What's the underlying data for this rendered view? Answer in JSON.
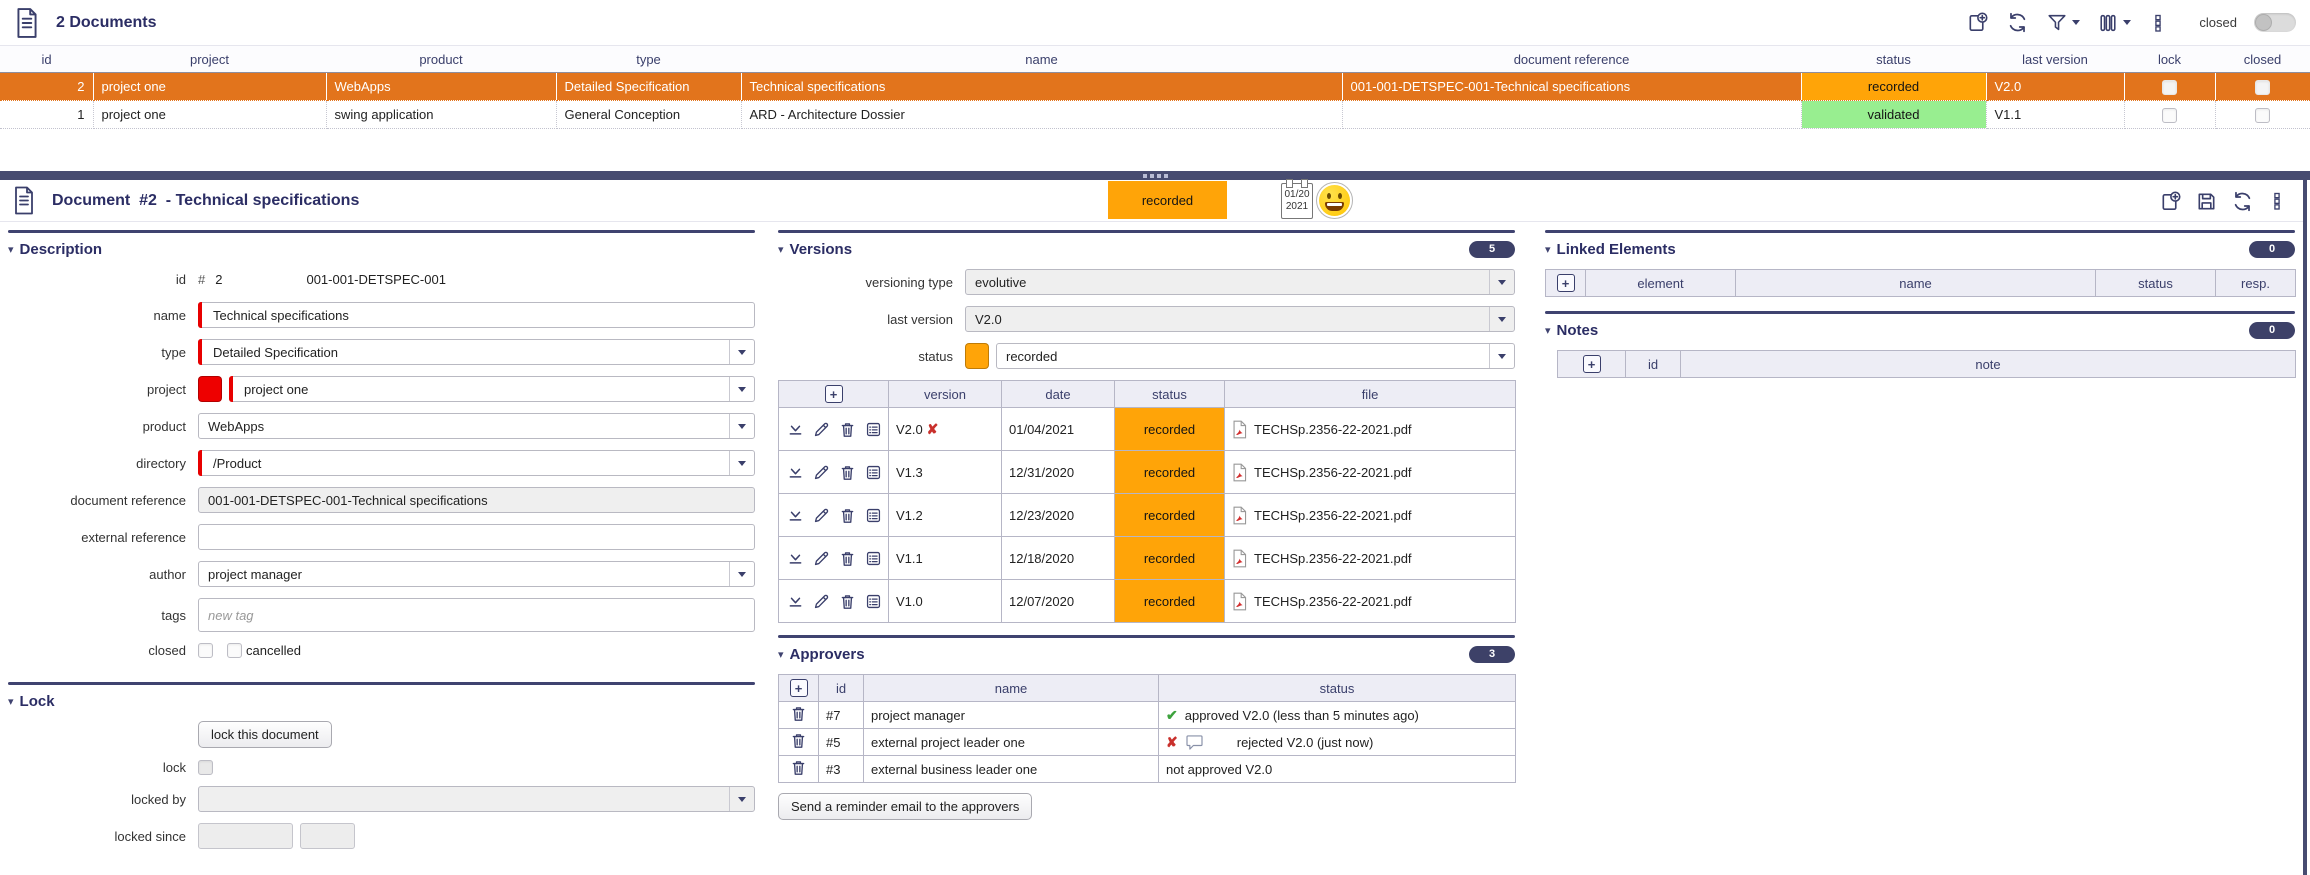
{
  "colors": {
    "accent_navy": "#2B2D64",
    "selected_row": "#E2741C",
    "status": {
      "recorded": "#FFA408",
      "validated": "#98EE90"
    },
    "required_red": "#E80000",
    "count_pill": "#3D4168",
    "project_swatch": "#EE0000"
  },
  "icons": {
    "caret_down": "▾",
    "check_mark": "✔",
    "reject_cross": "✘",
    "remove_cross": "✘",
    "plus": "+"
  },
  "list": {
    "title": "2 Documents",
    "toolbar": {
      "closed_toggle_label": "closed"
    },
    "columns": [
      "id",
      "project",
      "product",
      "type",
      "name",
      "document reference",
      "status",
      "last version",
      "lock",
      "closed"
    ],
    "rows": [
      {
        "id": "2",
        "project": "project one",
        "product": "WebApps",
        "type": "Detailed Specification",
        "name": "Technical specifications",
        "document_reference": "001-001-DETSPEC-001-Technical specifications",
        "status": "recorded",
        "last_version": "V2.0",
        "lock": false,
        "closed": false,
        "selected": true
      },
      {
        "id": "1",
        "project": "project one",
        "product": "swing application",
        "type": "General Conception",
        "name": "ARD - Architecture Dossier",
        "document_reference": "",
        "status": "validated",
        "last_version": "V1.1",
        "lock": false,
        "closed": false,
        "selected": false
      }
    ]
  },
  "detail": {
    "title": "Document  #2  - Technical specifications",
    "status_badge": "recorded",
    "calendar": {
      "month_day": "01/20",
      "year": "2021"
    },
    "description": {
      "title": "Description",
      "id_label": "id",
      "id_hash": "#",
      "id_value": "2",
      "id_reference": "001-001-DETSPEC-001",
      "name_label": "name",
      "name_value": "Technical specifications",
      "type_label": "type",
      "type_value": "Detailed Specification",
      "project_label": "project",
      "project_value": "project one",
      "product_label": "product",
      "product_value": "WebApps",
      "directory_label": "directory",
      "directory_value": "/Product",
      "document_reference_label": "document reference",
      "document_reference_value": "001-001-DETSPEC-001-Technical specifications",
      "external_reference_label": "external reference",
      "external_reference_value": "",
      "author_label": "author",
      "author_value": "project manager",
      "tags_label": "tags",
      "tags_placeholder": "new tag",
      "closed_label": "closed",
      "cancelled_label": "cancelled"
    },
    "lock": {
      "title": "Lock",
      "lock_button_label": "lock this document",
      "lock_label": "lock",
      "locked_by_label": "locked by",
      "locked_since_label": "locked since"
    },
    "versions": {
      "title": "Versions",
      "count": "5",
      "versioning_type_label": "versioning type",
      "versioning_type_value": "evolutive",
      "last_version_label": "last version",
      "last_version_value": "V2.0",
      "status_label": "status",
      "status_value": "recorded",
      "columns": [
        "",
        "version",
        "date",
        "status",
        "file"
      ],
      "rows": [
        {
          "version": "V2.0",
          "removable": true,
          "date": "01/04/2021",
          "status": "recorded",
          "file": "TECHSp.2356-22-2021.pdf"
        },
        {
          "version": "V1.3",
          "removable": false,
          "date": "12/31/2020",
          "status": "recorded",
          "file": "TECHSp.2356-22-2021.pdf"
        },
        {
          "version": "V1.2",
          "removable": false,
          "date": "12/23/2020",
          "status": "recorded",
          "file": "TECHSp.2356-22-2021.pdf"
        },
        {
          "version": "V1.1",
          "removable": false,
          "date": "12/18/2020",
          "status": "recorded",
          "file": "TECHSp.2356-22-2021.pdf"
        },
        {
          "version": "V1.0",
          "removable": false,
          "date": "12/07/2020",
          "status": "recorded",
          "file": "TECHSp.2356-22-2021.pdf"
        }
      ]
    },
    "approvers": {
      "title": "Approvers",
      "count": "3",
      "columns": [
        "",
        "id",
        "name",
        "status"
      ],
      "rows": [
        {
          "id": "#7",
          "name": "project manager",
          "status_icon": "approved",
          "status": "approved V2.0 (less than 5 minutes ago)"
        },
        {
          "id": "#5",
          "name": "external project leader one",
          "status_icon": "rejected",
          "status": "rejected V2.0 (just now)"
        },
        {
          "id": "#3",
          "name": "external business leader one",
          "status_icon": "none",
          "status": "not approved V2.0"
        }
      ],
      "reminder_button_label": "Send a reminder email to the approvers"
    },
    "linked_elements": {
      "title": "Linked Elements",
      "count": "0",
      "columns": [
        "element",
        "name",
        "status",
        "resp."
      ]
    },
    "notes": {
      "title": "Notes",
      "count": "0",
      "columns": [
        "id",
        "note"
      ]
    }
  }
}
